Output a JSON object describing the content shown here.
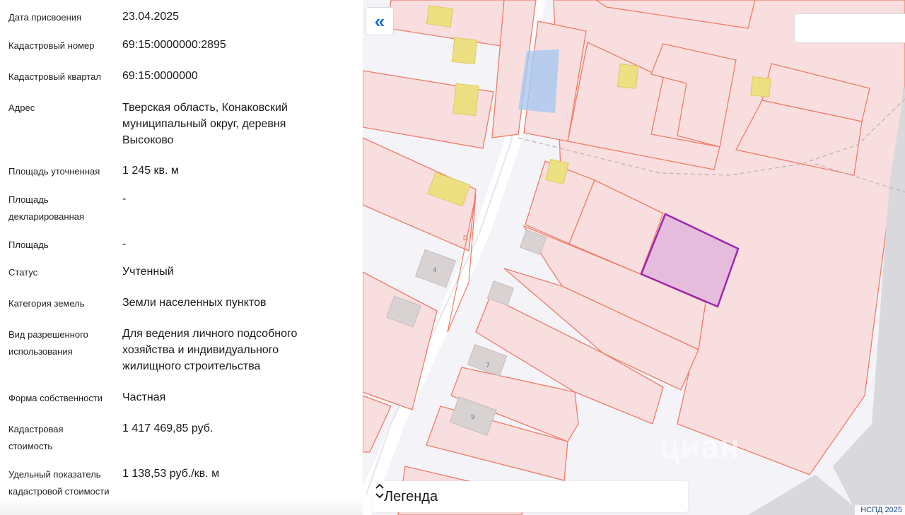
{
  "info": {
    "rows": [
      {
        "label": "Дата присвоения",
        "value": "23.04.2025"
      },
      {
        "label": "Кадастровый номер",
        "value": "69:15:0000000:2895"
      },
      {
        "label": "Кадастровый квартал",
        "value": "69:15:0000000"
      },
      {
        "label": "Адрес",
        "value": "Тверская область, Конаковский муниципальный округ, деревня Высоково"
      },
      {
        "label": "Площадь уточненная",
        "value": "1 245 кв. м"
      },
      {
        "label": "Площадь декларированная",
        "value": "-"
      },
      {
        "label": "Площадь",
        "value": "-"
      },
      {
        "label": "Статус",
        "value": "Учтенный"
      },
      {
        "label": "Категория земель",
        "value": "Земли населенных пунктов"
      },
      {
        "label": "Вид разрешенного использования",
        "value": "Для ведения личного подсобного хозяйства и индивидуального жилищного строительства"
      },
      {
        "label": "Форма собственности",
        "value": "Частная"
      },
      {
        "label": "Кадастровая стоимость",
        "value": "1 417 469,85 руб."
      },
      {
        "label": "Удельный показатель кадастровой стоимости",
        "value": "1 138,53 руб./кв. м"
      }
    ]
  },
  "map": {
    "collapse_icon": "«",
    "legend_title": "Легенда",
    "credit": "НСПД 2025",
    "watermark": "циан",
    "house_numbers": [
      "4",
      "7",
      "9"
    ],
    "colors": {
      "parcel_fill": "#f8dede",
      "parcel_stroke": "#ee7d69",
      "selected_fill": "#e6bcdc",
      "selected_stroke": "#9c27b0",
      "building_fill": "#ede082",
      "water_fill": "#a8c8f0",
      "accent": "#1b6fd6"
    }
  }
}
